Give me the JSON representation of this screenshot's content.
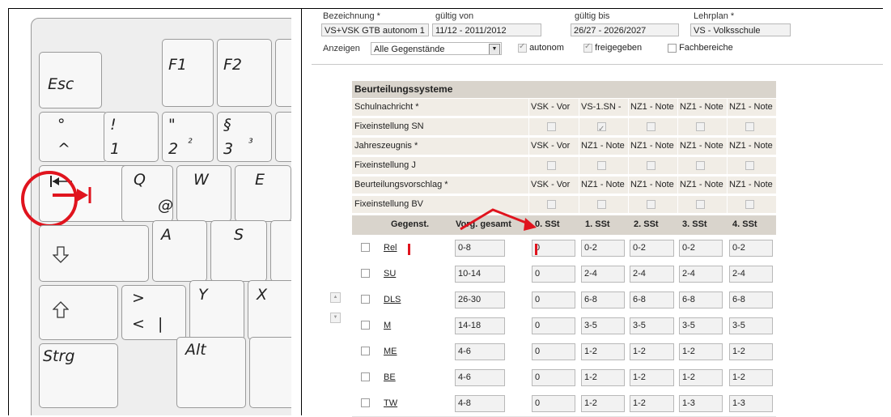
{
  "keyboard": {
    "keys": {
      "esc": "Esc",
      "f1": "F1",
      "f2": "F2",
      "circ_top": "°",
      "circ_bottom": "^",
      "k1_top": "!",
      "k1_bottom": "1",
      "k2_top": "\"",
      "k2_bottom": "2",
      "k2_sup": "²",
      "k3_top": "§",
      "k3_bottom": "3",
      "k3_sup": "³",
      "q": "Q",
      "q_alt": "@",
      "w": "W",
      "e": "E",
      "a": "A",
      "s": "S",
      "lt_top": ">",
      "lt_bottom": "<",
      "lt_alt": "|",
      "y": "Y",
      "x": "X",
      "strg": "Strg",
      "alt": "Alt"
    },
    "highlight_color": "#e0141e"
  },
  "form": {
    "bezeichnung_label": "Bezeichnung *",
    "bezeichnung_value": "VS+VSK GTB autonom 1",
    "gueltig_von_label": "gültig von",
    "gueltig_von_value": "11/12 - 2011/2012",
    "gueltig_bis_label": "gültig bis",
    "gueltig_bis_value": "26/27 - 2026/2027",
    "lehrplan_label": "Lehrplan *",
    "lehrplan_value": "VS - Volksschule",
    "anzeigen_label": "Anzeigen",
    "anzeigen_value": "Alle Gegenstände",
    "autonom_label": "autonom",
    "freigegeben_label": "freigegeben",
    "fachbereiche_label": "Fachbereiche"
  },
  "beurteilung": {
    "title": "Beurteilungssysteme",
    "rows": [
      {
        "name": "Schulnachricht *",
        "type": "text",
        "cells": [
          "VSK - Vor",
          "VS-1.SN -",
          "NZ1 - Note",
          "NZ1 - Note",
          "NZ1 - Note"
        ]
      },
      {
        "name": "Fixeinstellung SN",
        "type": "check",
        "cells": [
          false,
          true,
          false,
          false,
          false
        ]
      },
      {
        "name": "Jahreszeugnis *",
        "type": "text",
        "cells": [
          "VSK - Vor",
          "NZ1 - Note",
          "NZ1 - Note",
          "NZ1 - Note",
          "NZ1 - Note"
        ]
      },
      {
        "name": "Fixeinstellung J",
        "type": "check",
        "cells": [
          false,
          false,
          false,
          false,
          false
        ]
      },
      {
        "name": "Beurteilungsvorschlag *",
        "type": "text",
        "cells": [
          "VSK - Vor",
          "NZ1 - Note",
          "NZ1 - Note",
          "NZ1 - Note",
          "NZ1 - Note"
        ]
      },
      {
        "name": "Fixeinstellung BV",
        "type": "check",
        "cells": [
          false,
          false,
          false,
          false,
          false
        ]
      }
    ]
  },
  "grid": {
    "headers": [
      "Gegenst.",
      "Vorg. gesamt",
      "0. SSt",
      "1. SSt",
      "2. SSt",
      "3. SSt",
      "4. SSt"
    ],
    "rows": [
      {
        "subject": "Rel",
        "values": [
          "0-8",
          "0",
          "0-2",
          "0-2",
          "0-2",
          "0-2"
        ]
      },
      {
        "subject": "SU",
        "values": [
          "10-14",
          "0",
          "2-4",
          "2-4",
          "2-4",
          "2-4"
        ]
      },
      {
        "subject": "DLS",
        "values": [
          "26-30",
          "0",
          "6-8",
          "6-8",
          "6-8",
          "6-8"
        ]
      },
      {
        "subject": "M",
        "values": [
          "14-18",
          "0",
          "3-5",
          "3-5",
          "3-5",
          "3-5"
        ]
      },
      {
        "subject": "ME",
        "values": [
          "4-6",
          "0",
          "1-2",
          "1-2",
          "1-2",
          "1-2"
        ]
      },
      {
        "subject": "BE",
        "values": [
          "4-6",
          "0",
          "1-2",
          "1-2",
          "1-2",
          "1-2"
        ]
      },
      {
        "subject": "TW",
        "values": [
          "4-8",
          "0",
          "1-2",
          "1-2",
          "1-3",
          "1-3"
        ]
      }
    ]
  }
}
